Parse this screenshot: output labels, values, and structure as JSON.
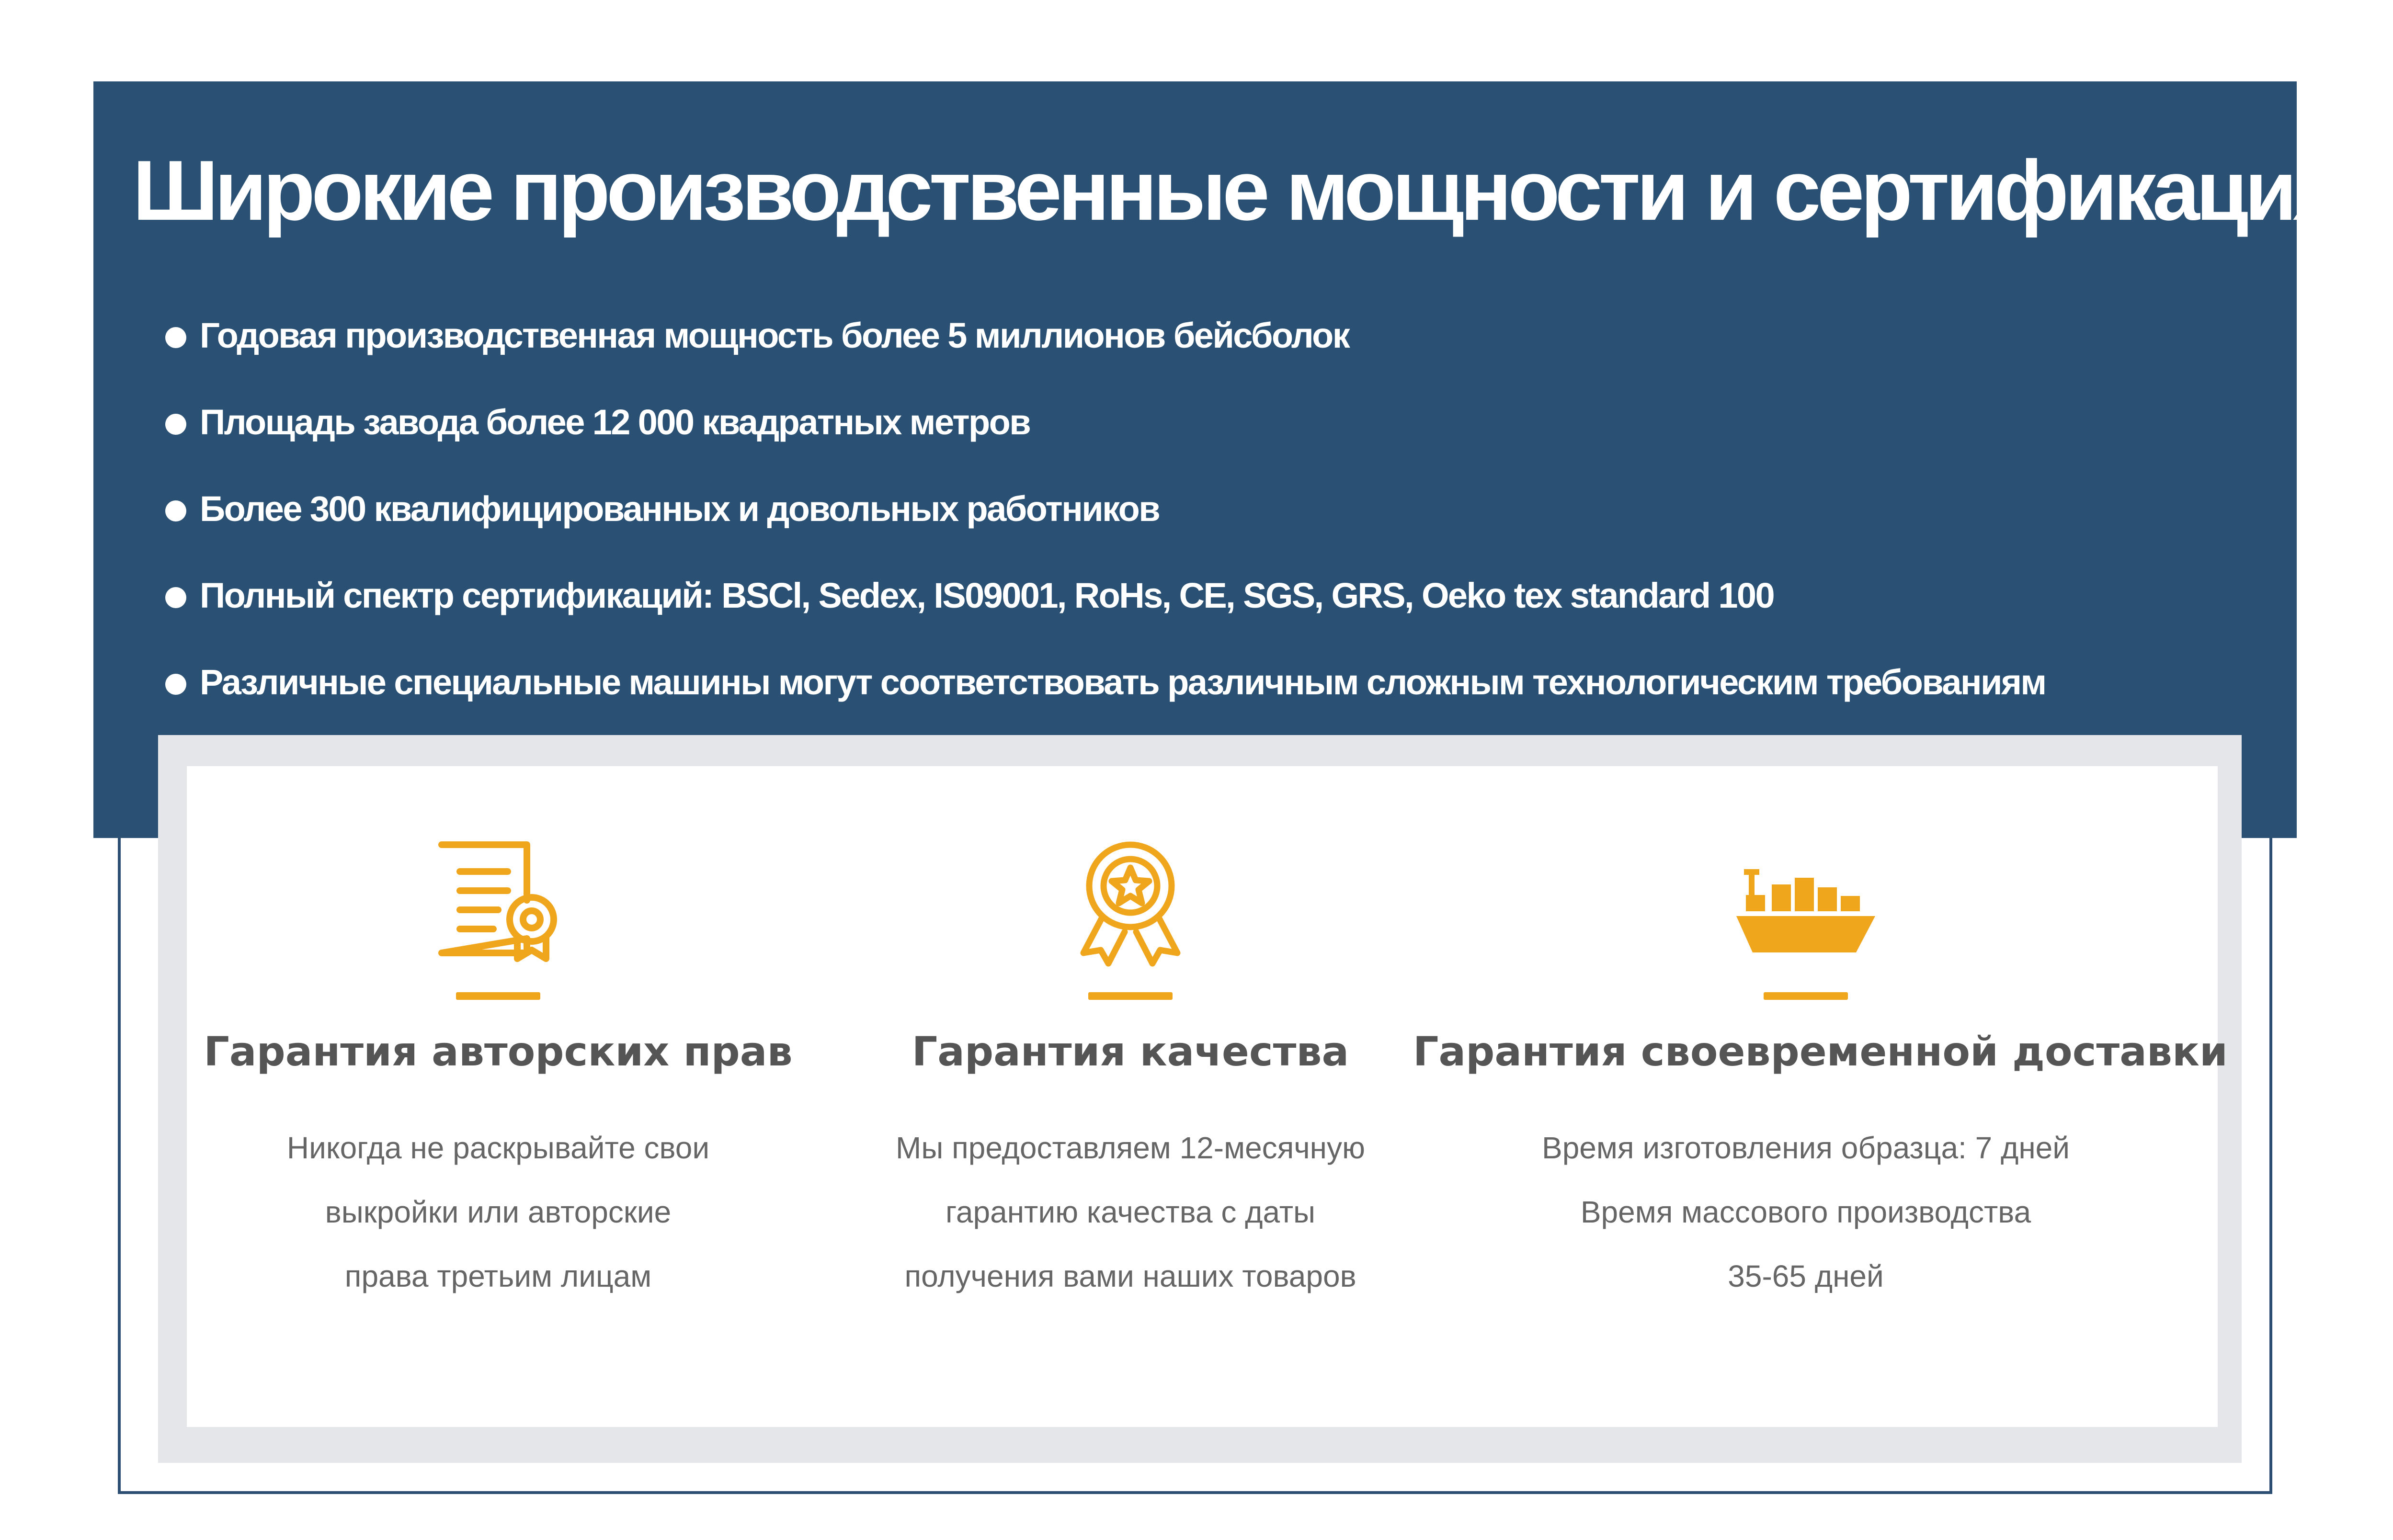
{
  "colors": {
    "panel": "#2a5174",
    "accent": "#f0a61c",
    "title_text": "#555555",
    "body_text": "#666666"
  },
  "header": {
    "title": "Широкие производственные мощности и сертификация"
  },
  "bullets": [
    "Годовая производственная мощность более 5 миллионов бейсболок",
    "Площадь завода более 12 000 квадратных метров",
    "Более 300 квалифицированных и довольных работников",
    "Полный спектр сертификаций: BSCl, Sedex, IS09001, RoHs, CE, SGS, GRS, Oeko tex standard 100",
    "Различные специальные машины могут соответствовать различным сложным технологическим требованиям"
  ],
  "features": [
    {
      "icon": "certificate-icon",
      "title": "Гарантия авторских прав",
      "lines": [
        "Никогда не раскрывайте свои",
        "выкройки или авторские",
        "права третьим лицам"
      ]
    },
    {
      "icon": "award-badge-icon",
      "title": "Гарантия качества",
      "lines": [
        "Мы предоставляем 12-месячную",
        "гарантию качества с даты",
        "получения вами наших товаров"
      ]
    },
    {
      "icon": "cargo-ship-icon",
      "title": "Гарантия своевременной доставки",
      "lines": [
        "Время изготовления образца: 7 дней",
        "Время массового производства",
        "35-65 дней"
      ]
    }
  ]
}
